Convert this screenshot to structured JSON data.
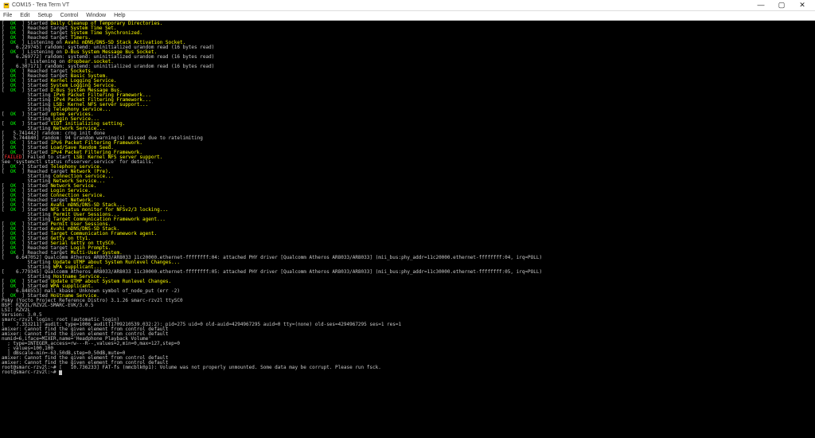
{
  "window": {
    "title": "COM15 - Tera Term VT",
    "minimize": "—",
    "maximize": "▢",
    "close": "✕"
  },
  "menu": {
    "file": "File",
    "edit": "Edit",
    "setup": "Setup",
    "control": "Control",
    "window": "Window",
    "help": "Help"
  },
  "term": {
    "ok": "OK",
    "failed": "FAILED",
    "lines": [
      {
        "p": "[  ",
        "s": "OK",
        "m": "  ] Started ",
        "y": "Daily Cleanup of Temporary Directories."
      },
      {
        "p": "[  ",
        "s": "OK",
        "m": "  ] Reached target ",
        "y": "System Time Set."
      },
      {
        "p": "[  ",
        "s": "OK",
        "m": "  ] Reached target ",
        "y": "System Time Synchronized."
      },
      {
        "p": "[  ",
        "s": "OK",
        "m": "  ] Reached target ",
        "y": "Timers."
      },
      {
        "p": "[  ",
        "s": "OK",
        "m": "  ] Listening on ",
        "y": "Avahi mDNS/DNS-SD Stack Activation Socket."
      },
      {
        "p": "[    6.229745] random: systemd: uninitialized urandom read (16 bytes read)"
      },
      {
        "p": "[  ",
        "s": "OK",
        "m": "  ] Listening on ",
        "y": "D-Bus System Message Bus Socket."
      },
      {
        "p": "[    6.269772] random: systemd: uninitialized urandom read (16 bytes read)"
      },
      {
        "p": "[       ] Listening on ",
        "y": "dropbear.socket."
      },
      {
        "p": "[    6.307171] random: systemd: uninitialized urandom read (16 bytes read)"
      },
      {
        "p": "[  ",
        "s": "OK",
        "m": "  ] Reached target ",
        "y": "Sockets."
      },
      {
        "p": "[  ",
        "s": "OK",
        "m": "  ] Reached target ",
        "y": "Basic System."
      },
      {
        "p": "[  ",
        "s": "OK",
        "m": "  ] Started ",
        "y": "Kernel Logging Service."
      },
      {
        "p": "[  ",
        "s": "OK",
        "m": "  ] Started ",
        "y": "System Logging Service."
      },
      {
        "p": "[  ",
        "s": "OK",
        "m": "  ] Started ",
        "y": "D-Bus System Message Bus."
      },
      {
        "p": "         Starting ",
        "y": "IPv6 Packet Filtering Framework..."
      },
      {
        "p": "         Starting ",
        "y": "IPv4 Packet Filtering Framework..."
      },
      {
        "p": "         Starting ",
        "y": "LSB: Kernel NFS server support..."
      },
      {
        "p": "         Starting ",
        "y": "Telephony service..."
      },
      {
        "p": "[  ",
        "s": "OK",
        "m": "  ] Started ",
        "y": "optee services."
      },
      {
        "p": "         Starting ",
        "y": "Login Service..."
      },
      {
        "p": "[  ",
        "s": "OK",
        "m": "  ] Started ",
        "y": "VIDT initializing setting."
      },
      {
        "p": "         Starting ",
        "y": "Network Service..."
      },
      {
        "p": "[   5.741442] random: crng init done"
      },
      {
        "p": "[   5.744840] random: 94 urandom warning(s) missed due to ratelimiting"
      },
      {
        "p": "[  ",
        "s": "OK",
        "m": "  ] Started ",
        "y": "IPv6 Packet Filtering Framework."
      },
      {
        "p": "[  ",
        "s": "OK",
        "m": "  ] Started ",
        "y": "Load/Save Random Seed."
      },
      {
        "p": "[  ",
        "s": "OK",
        "m": "  ] Started ",
        "y": "IPv4 Packet Filtering Framework."
      },
      {
        "p": "[",
        "s": "FAILED",
        "m": "] Failed to start ",
        "y": "LSB: Kernel NFS server support."
      },
      {
        "p": "See 'systemctl status nfsserver.service' for details."
      },
      {
        "p": "[  ",
        "s": "OK",
        "m": "  ] Started ",
        "y": "Telephony service."
      },
      {
        "p": "[  ",
        "s": "OK",
        "m": "  ] Reached target ",
        "y": "Network (Pre)."
      },
      {
        "p": "         Starting ",
        "y": "Connection service..."
      },
      {
        "p": "         Starting ",
        "y": "Network Service..."
      },
      {
        "p": "[  ",
        "s": "OK",
        "m": "  ] Started ",
        "y": "Network Service."
      },
      {
        "p": "[  ",
        "s": "OK",
        "m": "  ] Started ",
        "y": "Login Service."
      },
      {
        "p": "[  ",
        "s": "OK",
        "m": "  ] Started ",
        "y": "Connection service."
      },
      {
        "p": "[  ",
        "s": "OK",
        "m": "  ] Reached target ",
        "y": "Network."
      },
      {
        "p": "[  ",
        "s": "OK",
        "m": "  ] Started ",
        "y": "Avahi mDNS/DNS-SD Stack..."
      },
      {
        "p": "[  ",
        "s": "OK",
        "m": "  ] Started ",
        "y": "NFS status monitor for NFSv2/3 locking..."
      },
      {
        "p": "         Starting ",
        "y": "Permit User Sessions..."
      },
      {
        "p": "         Starting ",
        "y": "Target Communication Framework agent..."
      },
      {
        "p": "[  ",
        "s": "OK",
        "m": "  ] Started ",
        "y": "Permit User Sessions."
      },
      {
        "p": "[  ",
        "s": "OK",
        "m": "  ] Started ",
        "y": "Avahi mDNS/DNS-SD Stack."
      },
      {
        "p": "[  ",
        "s": "OK",
        "m": "  ] Started ",
        "y": "Target Communication Framework agent."
      },
      {
        "p": "[  ",
        "s": "OK",
        "m": "  ] Started ",
        "y": "Getty on tty1."
      },
      {
        "p": "[  ",
        "s": "OK",
        "m": "  ] Started ",
        "y": "Serial Getty on ttySC0."
      },
      {
        "p": "[  ",
        "s": "OK",
        "m": "  ] Reached target ",
        "y": "Login Prompts."
      },
      {
        "p": "[  ",
        "s": "OK",
        "m": "  ] Reached target ",
        "y": "Multi-User System."
      },
      {
        "p": "[    6.647052] Qualcomm Atheros AR8033/AR8033 11c20000.ethernet-ffffffff:04: attached PHY driver [Qualcomm Atheros AR8033/AR8033] (mii_bus:phy_addr=11c20000.ethernet-ffffffff:04, irq=POLL)"
      },
      {
        "p": "         Starting ",
        "y": "Update UTMP about System Runlevel Changes..."
      },
      {
        "p": "         Starting ",
        "y": "WPA supplicant..."
      },
      {
        "p": "[    6.779345] Qualcomm Atheros AR8033/AR8033 11c30000.ethernet-ffffffff:05: attached PHY driver [Qualcomm Atheros AR8033/AR8033] (mii_bus:phy_addr=11c30000.ethernet-ffffffff:05, irq=POLL)"
      },
      {
        "p": "         Starting ",
        "y": "Hostname Service..."
      },
      {
        "p": "[  ",
        "s": "OK",
        "m": "  ] Started ",
        "y": "Update UTMP about System Runlevel Changes."
      },
      {
        "p": "[  ",
        "s": "OK",
        "m": "  ] Started ",
        "y": "WPA supplicant."
      },
      {
        "p": "[    6.848553] mali_kbase: Unknown symbol of_node_put (err -2)"
      },
      {
        "p": "[  ",
        "s": "OK",
        "m": "  ] Started ",
        "y": "Hostname Service."
      },
      {
        "p": ""
      },
      {
        "p": "Poky (Yocto Project Reference Distro) 3.1.26 smarc-rzv2l ttySC0"
      },
      {
        "p": ""
      },
      {
        "p": "BSP: RZV2L/RZV2L-SMARC-EVK/3.0.5"
      },
      {
        "p": "LSI: RZV2L"
      },
      {
        "p": "Version: 3.0.5"
      },
      {
        "p": "smarc-rzv2l login: root (automatic login)"
      },
      {
        "p": ""
      },
      {
        "p": "[    7.353211] audit: type=1006 audit(1709210539.032:2): pid=275 uid=0 old-auid=4294967295 auid=0 tty=(none) old-ses=4294967295 ses=1 res=1"
      },
      {
        "p": "amixer: Cannot find the given element from control default"
      },
      {
        "p": ""
      },
      {
        "p": "amixer: Cannot find the given element from control default"
      },
      {
        "p": ""
      },
      {
        "p": "numid=6,iface=MIXER,name='Headphone Playback Volume'"
      },
      {
        "p": "  ; type=INTEGER,access=rw---R--,values=2,min=0,max=127,step=0"
      },
      {
        "p": "  ; values=100,100"
      },
      {
        "p": "  | dBscale-min=-63.50dB,step=0.50dB,mute=0"
      },
      {
        "p": "amixer: Cannot find the given element from control default"
      },
      {
        "p": ""
      },
      {
        "p": "amixer: Cannot find the given element from control default"
      },
      {
        "p": ""
      },
      {
        "p": "root@smarc-rzv2l:~# [   10.736233] FAT-fs (mmcblk0p1): Volume was not properly unmounted. Some data may be corrupt. Please run fsck."
      },
      {
        "p": ""
      },
      {
        "p": "root@smarc-rzv2l:~# ",
        "cursor": true
      }
    ]
  }
}
